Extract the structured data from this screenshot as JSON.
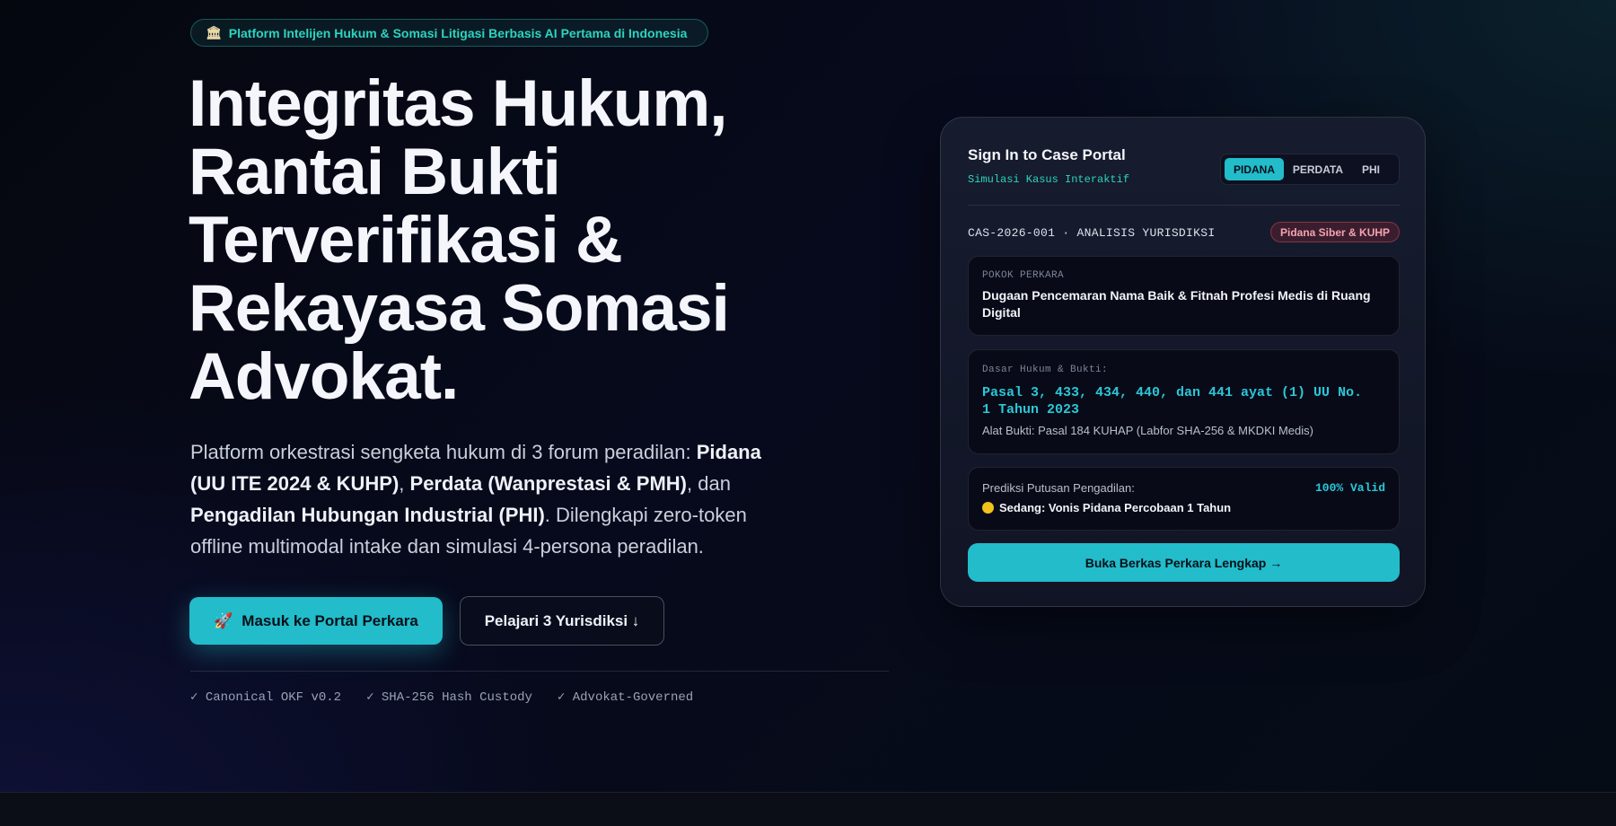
{
  "badge": {
    "icon": "classical-building-icon",
    "icon_glyph": "🏛",
    "text": "Platform Intelijen Hukum & Somasi Litigasi Berbasis AI Pertama di Indonesia"
  },
  "hero": {
    "title_lines": [
      "Integritas Hukum,",
      "Rantai Bukti",
      "Terverifikasi &",
      "Rekayasa Somasi",
      "Advokat."
    ],
    "description": {
      "t1": "Platform orkestrasi sengketa hukum di 3 forum peradilan: ",
      "b1": "Pidana (UU ITE 2024 & KUHP)",
      "t2": ", ",
      "b2": "Perdata (Wanprestasi & PMH)",
      "t3": ", dan ",
      "b3": "Pengadilan Hubungan Industrial (PHI)",
      "t4": ". Dilengkapi zero-token offline multimodal intake dan simulasi 4-persona peradilan."
    },
    "primary_button": {
      "icon": "rocket-icon",
      "icon_glyph": "🚀",
      "label": "Masuk ke Portal Perkara"
    },
    "secondary_button": {
      "label": "Pelajari 3 Yurisdiksi ↓"
    },
    "trust_items": [
      "✓ Canonical OKF v0.2",
      "✓ SHA-256 Hash Custody",
      "✓ Advokat-Governed"
    ]
  },
  "card": {
    "title": "Sign In to Case Portal",
    "subtitle": "Simulasi Kasus Interaktif",
    "tabs": [
      {
        "label": "PIDANA",
        "active": true
      },
      {
        "label": "PERDATA",
        "active": false
      },
      {
        "label": "PHI",
        "active": false
      }
    ],
    "case_id": "CAS-2026-001 · ANALISIS YURISDIKSI",
    "case_tag": "Pidana Siber & KUHP",
    "subject": {
      "label": "POKOK PERKARA",
      "value": "Dugaan Pencemaran Nama Baik & Fitnah Profesi Medis di Ruang Digital"
    },
    "legal_basis": {
      "label": "Dasar Hukum & Bukti:",
      "articles": "Pasal 3, 433, 434, 440, dan 441 ayat (1) UU No. 1 Tahun 2023",
      "evidence": "Alat Bukti: Pasal 184 KUHAP (Labfor SHA-256 & MKDKI Medis)"
    },
    "prediction": {
      "label": "Prediksi Putusan Pengadilan:",
      "validity": "100% Valid",
      "verdict": "Sedang: Vonis Pidana Percobaan 1 Tahun",
      "verdict_color": "#f2c21b"
    },
    "open_button": "Buka Berkas Perkara Lengkap →"
  },
  "colors": {
    "accent": "#22bccb",
    "tag_red": "#f7a3ae",
    "background": "#070a1c"
  }
}
